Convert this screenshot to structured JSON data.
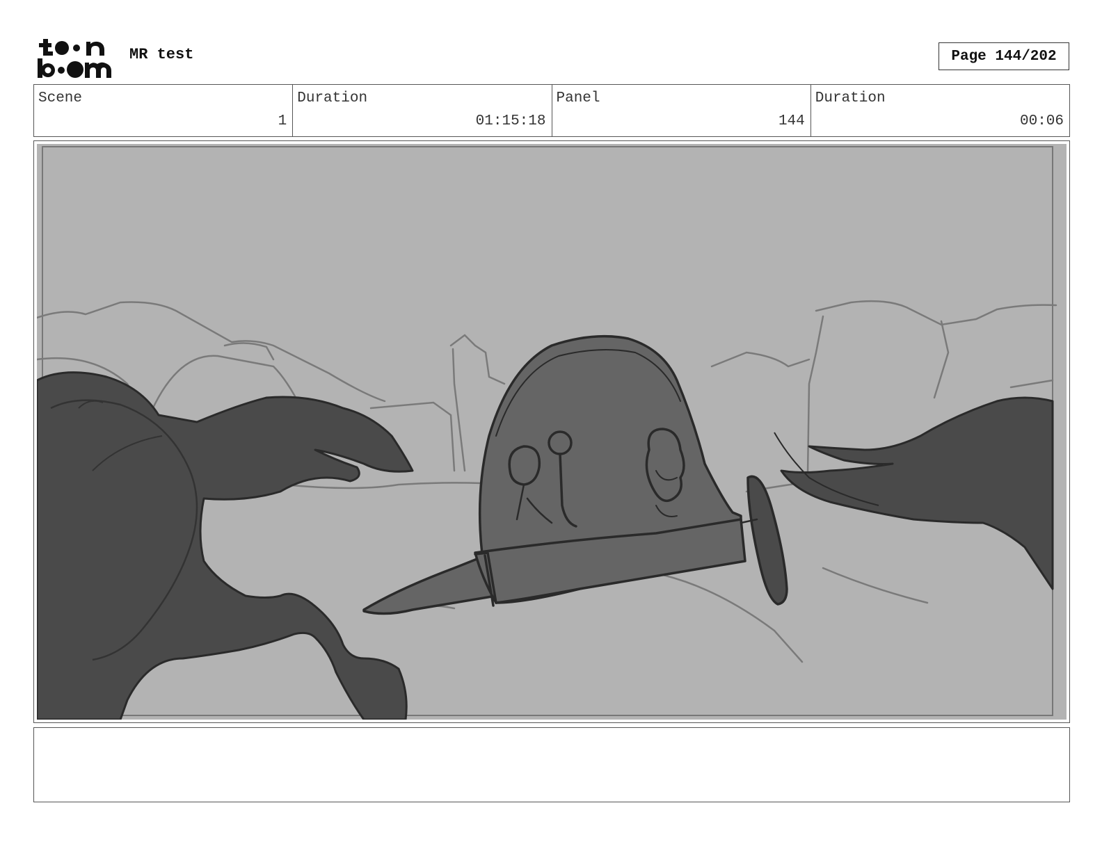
{
  "header": {
    "logo_alt": "toon boom",
    "project_title": "MR test",
    "page_label": "Page 144/202"
  },
  "info": [
    {
      "label": "Scene",
      "value": "1"
    },
    {
      "label": "Duration",
      "value": "01:15:18"
    },
    {
      "label": "Panel",
      "value": "144"
    },
    {
      "label": "Duration",
      "value": "00:06"
    }
  ],
  "panel": {
    "background_color": "#b3b3b3",
    "fill_color": "#4a4a4a",
    "mid_color": "#656565",
    "line_color": "#2a2a2a"
  },
  "notes": {
    "text": ""
  }
}
